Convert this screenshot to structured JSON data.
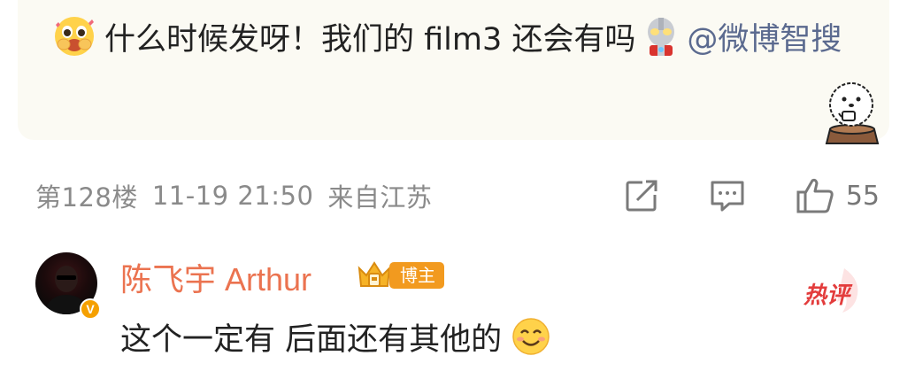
{
  "comment": {
    "text_before": "什么时候发呀！我们的 film3 还会有吗",
    "mention": "@微博智搜",
    "leading_emoji": "pleading-face-icon",
    "inline_emoji": "ultraman-icon"
  },
  "meta": {
    "floor": "第128楼",
    "timestamp": "11-19 21:50",
    "location": "来自江苏"
  },
  "actions": {
    "like_count": "55"
  },
  "reply": {
    "author": "陈飞宇 Arthur",
    "badge_label": "博主",
    "verified_mark": "V",
    "text": "这个一定有 后面还有其他的",
    "trailing_emoji": "smiling-face-icon",
    "hot_label": "热评"
  },
  "colors": {
    "bubble_bg": "#fbfaf3",
    "name_orange": "#eb7350",
    "mention_blue": "#5b6a8f",
    "hot_red": "#e33c3c",
    "badge_orange": "#f29a1f"
  }
}
